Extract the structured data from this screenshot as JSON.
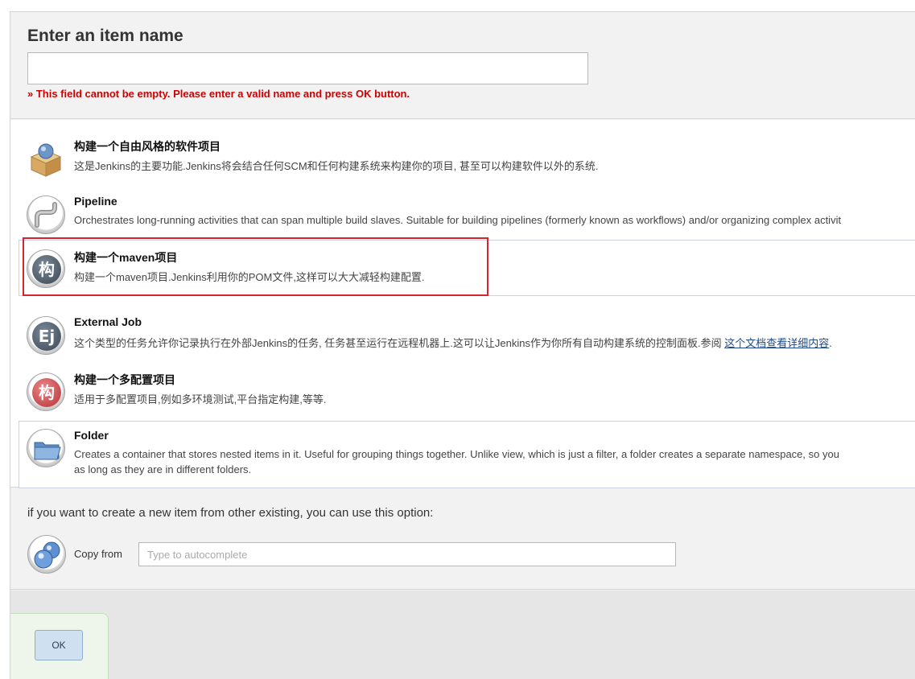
{
  "header": {
    "title": "Enter an item name",
    "name_value": "",
    "error": "» This field cannot be empty. Please enter a valid name and press OK button."
  },
  "items": [
    {
      "title": "构建一个自由风格的软件项目",
      "description": "这是Jenkins的主要功能.Jenkins将会结合任何SCM和任何构建系统来构建你的项目, 甚至可以构建软件以外的系统.",
      "icon": "freestyle-box-icon"
    },
    {
      "title": "Pipeline",
      "description": "Orchestrates long-running activities that can span multiple build slaves. Suitable for building pipelines (formerly known as workflows) and/or organizing complex activit",
      "icon": "pipeline-icon"
    },
    {
      "title": "构建一个maven项目",
      "description": "构建一个maven项目.Jenkins利用你的POM文件,这样可以大大减轻构建配置.",
      "icon": "maven-icon",
      "icon_glyph": "构"
    },
    {
      "title": "External Job",
      "description": "这个类型的任务允许你记录执行在外部Jenkins的任务, 任务甚至运行在远程机器上.这可以让Jenkins作为你所有自动构建系统的控制面板.参阅 ",
      "link": "这个文档查看详细内容",
      "description_tail": ".",
      "icon": "external-job-icon",
      "icon_glyph": "Ej"
    },
    {
      "title": "构建一个多配置项目",
      "description": "适用于多配置项目,例如多环境测试,平台指定构建,等等.",
      "icon": "matrix-icon",
      "icon_glyph": "构"
    },
    {
      "title": "Folder",
      "description": "Creates a container that stores nested items in it. Useful for grouping things together. Unlike view, which is just a filter, a folder creates a separate namespace, so you",
      "description_line2": "as long as they are in different folders.",
      "icon": "folder-icon"
    }
  ],
  "copy": {
    "hint": "if you want to create a new item from other existing, you can use this option:",
    "label": "Copy from",
    "placeholder": "Type to autocomplete",
    "icon": "copy-icon"
  },
  "footer": {
    "ok_label": "OK"
  },
  "colors": {
    "error": "#d10000",
    "highlight_box": "#d9232e",
    "link": "#204a87",
    "ok_button_bg": "#cfe0f0"
  }
}
